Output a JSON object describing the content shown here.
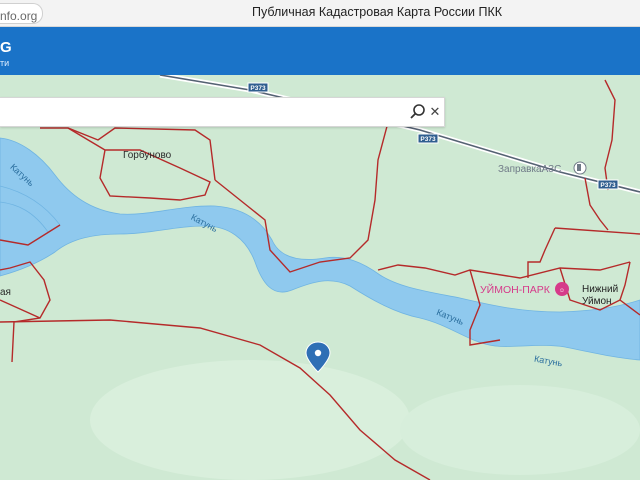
{
  "browser": {
    "url_fragment": "nfo.org",
    "page_title": "Публичная Кадастровая Карта России ПКК"
  },
  "header": {
    "logo_text": "G",
    "logo_subtitle": "ти"
  },
  "search": {
    "value": "",
    "placeholder": ""
  },
  "map": {
    "colors": {
      "land": "#cfe9d3",
      "river": "#8fc9ee",
      "border": "#b52a2a",
      "road": "#e6e9ef",
      "header": "#1a73c8"
    },
    "labels": {
      "gorbunovo": "Горбуново",
      "katun_1": "Катунь",
      "katun_2": "Катунь",
      "katun_3": "Катунь",
      "katun_4": "Катунь",
      "fuel_station": "ЗаправкаАЗС",
      "park": "УЙМОН-ПАРК",
      "nizhny_line1": "Нижний",
      "nizhny_line2": "Уймон",
      "left_partial": "ая"
    },
    "road_shields": [
      "P373",
      "P373",
      "P373"
    ]
  }
}
